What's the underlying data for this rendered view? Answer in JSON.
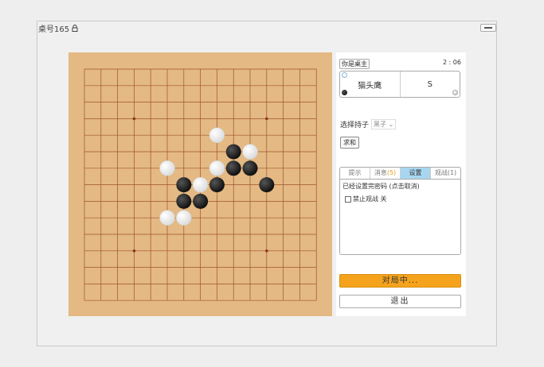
{
  "window": {
    "title": "桌号165"
  },
  "board": {
    "size": 15,
    "stones": [
      {
        "color": "white",
        "col": 8,
        "row": 4
      },
      {
        "color": "black",
        "col": 9,
        "row": 5
      },
      {
        "color": "white",
        "col": 10,
        "row": 5
      },
      {
        "color": "white",
        "col": 5,
        "row": 6
      },
      {
        "color": "white",
        "col": 8,
        "row": 6
      },
      {
        "color": "black",
        "col": 9,
        "row": 6
      },
      {
        "color": "black",
        "col": 10,
        "row": 6
      },
      {
        "color": "black",
        "col": 6,
        "row": 7
      },
      {
        "color": "white",
        "col": 7,
        "row": 7
      },
      {
        "color": "black",
        "col": 8,
        "row": 7
      },
      {
        "color": "black",
        "col": 11,
        "row": 7
      },
      {
        "color": "black",
        "col": 6,
        "row": 8
      },
      {
        "color": "black",
        "col": 7,
        "row": 8
      },
      {
        "color": "white",
        "col": 5,
        "row": 9
      },
      {
        "color": "white",
        "col": 6,
        "row": 9
      }
    ]
  },
  "panel": {
    "host_tag": "你是桌主",
    "timer": "2 : 06",
    "player_left": "猫头鹰",
    "player_right": "S",
    "choose_label": "选择持子",
    "choose_value": "黑子",
    "draw_label": "求和",
    "tabs": [
      {
        "label": "提示",
        "count": ""
      },
      {
        "label": "消息",
        "count": "(5)"
      },
      {
        "label": "设置",
        "count": ""
      },
      {
        "label": "观战",
        "count": "(1)"
      }
    ],
    "settings_line": "已经设置完密码 (点击取消)",
    "forbid_watch_label": "禁止观战 关",
    "status_label": "对局中...",
    "exit_label": "退出"
  }
}
